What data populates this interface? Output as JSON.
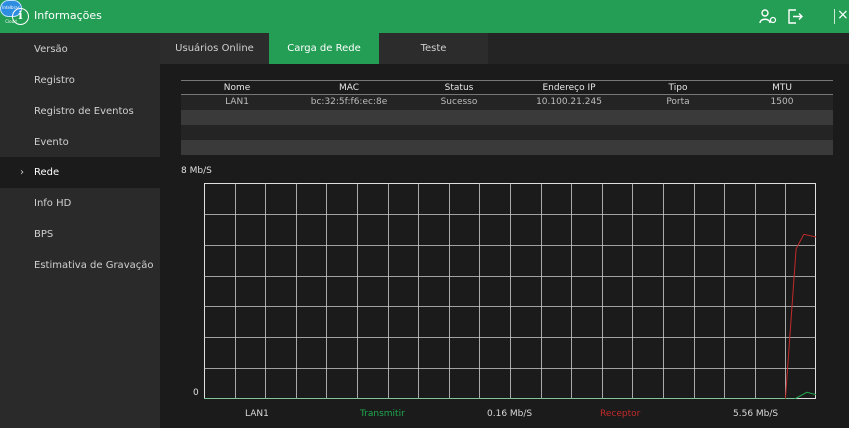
{
  "titlebar": {
    "title": "Informações",
    "cloud_text": "Intelbras Cloud"
  },
  "sidebar": {
    "items": [
      {
        "label": "Versão"
      },
      {
        "label": "Registro"
      },
      {
        "label": "Registro de Eventos"
      },
      {
        "label": "Evento"
      },
      {
        "label": "Rede",
        "active": true,
        "chevron": "›"
      },
      {
        "label": "Info HD"
      },
      {
        "label": "BPS"
      },
      {
        "label": "Estimativa de Gravação"
      }
    ]
  },
  "tabs": [
    {
      "label": "Usuários Online"
    },
    {
      "label": "Carga de Rede",
      "active": true
    },
    {
      "label": "Teste"
    }
  ],
  "table": {
    "headers": [
      "Nome",
      "MAC",
      "Status",
      "Endereço IP",
      "Tipo",
      "MTU"
    ],
    "rows": [
      [
        "LAN1",
        "bc:32:5f:f6:ec:8e",
        "Sucesso",
        "10.100.21.245",
        "Porta",
        "1500"
      ]
    ]
  },
  "chart_data": {
    "type": "line",
    "y_max_label": "8 Mb/S",
    "y_min_label": "0",
    "ylim": [
      0,
      8
    ],
    "grid": true,
    "grid_columns": 20,
    "grid_rows": 7,
    "series": [
      {
        "name": "Receptor",
        "color": "#c22a2a",
        "points": [
          [
            0,
            0
          ],
          [
            19,
            0
          ],
          [
            19.35,
            5.56
          ],
          [
            19.6,
            6.1
          ],
          [
            20,
            6.0
          ]
        ]
      },
      {
        "name": "Transmitir",
        "color": "#1fa84e",
        "points": [
          [
            0,
            0
          ],
          [
            19.3,
            0
          ],
          [
            19.7,
            0.25
          ],
          [
            20,
            0.16
          ]
        ]
      }
    ]
  },
  "legend": {
    "interface": "LAN1",
    "tx_label": "Transmitir",
    "tx_value": "0.16 Mb/S",
    "rx_label": "Receptor",
    "rx_value": "5.56 Mb/S"
  },
  "colors": {
    "accent": "#249e55",
    "tx": "#1fa84e",
    "rx": "#c22a2a"
  }
}
